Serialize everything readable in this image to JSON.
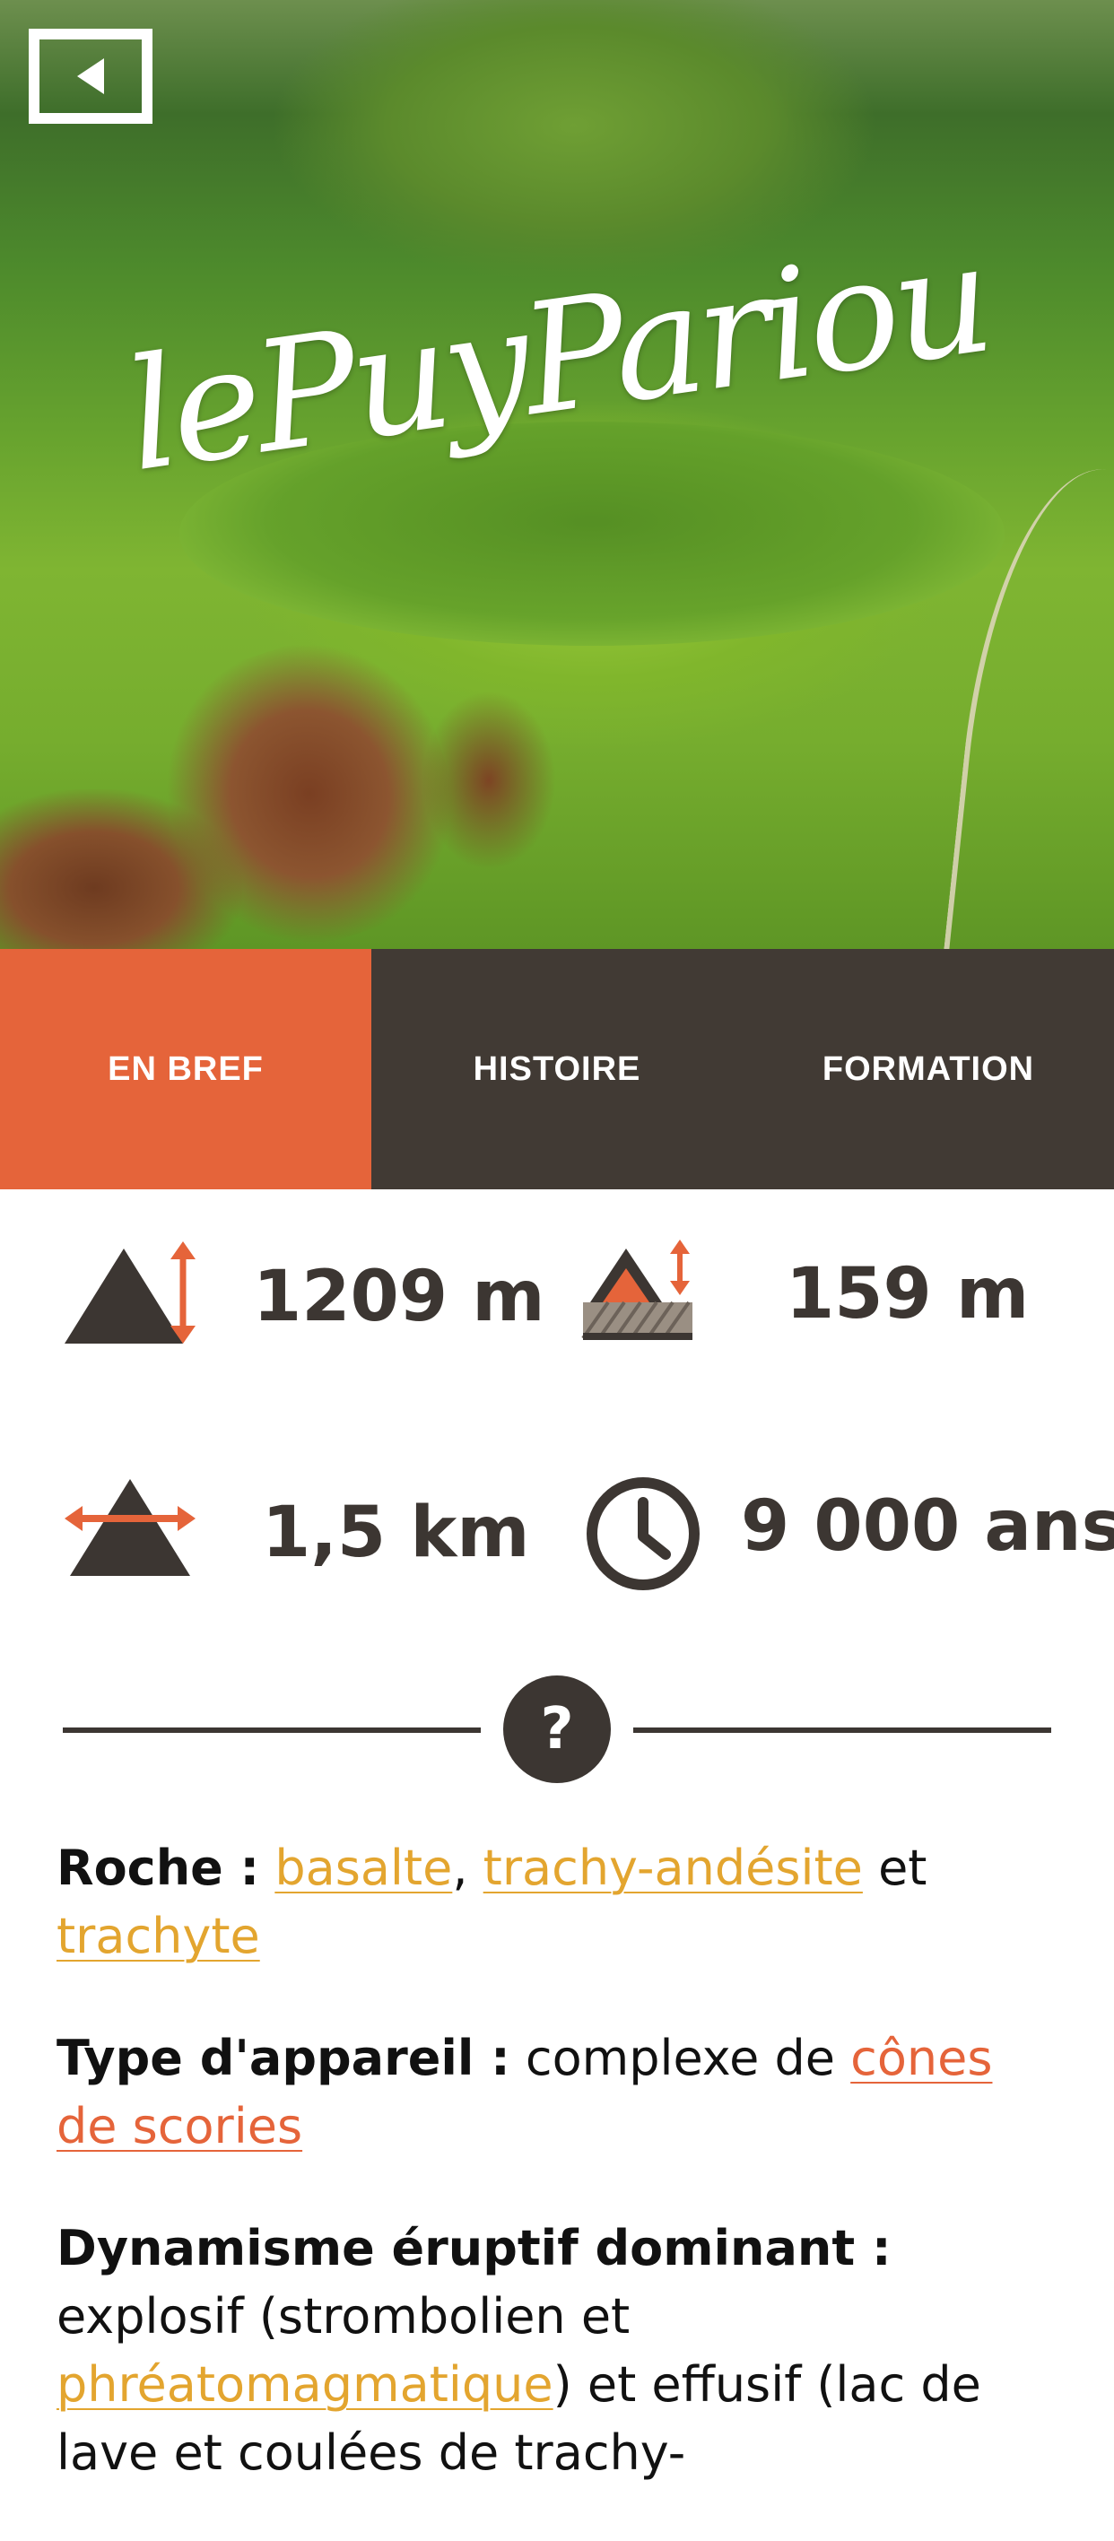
{
  "header": {
    "logo_text": "lePuyPariou",
    "back_icon": "back-arrow-icon"
  },
  "tabs": [
    {
      "label": "EN BREF",
      "active": true
    },
    {
      "label": "HISTOIRE",
      "active": false
    },
    {
      "label": "FORMATION",
      "active": false
    }
  ],
  "stats": {
    "altitude": {
      "icon": "altitude-icon",
      "value": "1209 m"
    },
    "relative_height": {
      "icon": "relative-height-icon",
      "value": "159 m"
    },
    "diameter": {
      "icon": "diameter-icon",
      "value": "1,5 km"
    },
    "age": {
      "icon": "clock-icon",
      "value": "9 000 ans"
    }
  },
  "help": {
    "symbol": "?"
  },
  "details": {
    "roche": {
      "label": "Roche :",
      "link1": "basalte",
      "sep": ",",
      "link2": "trachy-andésite",
      "conj": "et",
      "link3": "trachyte"
    },
    "type": {
      "label": "Type d'appareil :",
      "text": "complexe de",
      "link": "cônes de scories"
    },
    "dynamisme": {
      "label": "Dynamisme éruptif dominant :",
      "text1": "explosif (strombolien et",
      "link": "phréatomagmatique",
      "text2": ") et effusif (lac de lave et coulées de trachy-"
    }
  },
  "colors": {
    "accent_orange": "#e5643a",
    "link_yellow": "#e3a52f",
    "dark_brown": "#413a34"
  }
}
